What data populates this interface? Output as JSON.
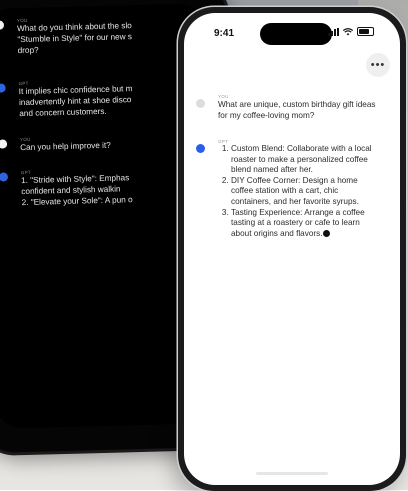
{
  "back_chat": {
    "msg1": {
      "role": "YOU",
      "lines": [
        "What do you think about the slo",
        "\"Stumble in Style\" for our new s",
        "drop?"
      ]
    },
    "msg2": {
      "role": "GPT",
      "lines": [
        "It implies chic confidence but m",
        "inadvertently hint at shoe disco",
        "and concern customers."
      ]
    },
    "msg3": {
      "role": "YOU",
      "lines": [
        "Can you help improve it?"
      ]
    },
    "msg4": {
      "role": "GPT",
      "lines": [
        "1. \"Stride with Style\": Emphas",
        "    confident and stylish walkin",
        "2. \"Elevate your Sole\": A pun o"
      ]
    }
  },
  "front_phone": {
    "status_time": "9:41",
    "menu_label": "•••",
    "user_role": "YOU",
    "user_text": "What are unique, custom birthday gift ideas for my coffee-loving mom?",
    "gpt_role": "GPT",
    "gpt_list": [
      "Custom Blend: Collaborate with a local roaster to make a personalized coffee blend named after her.",
      "DIY Coffee Corner: Design a home coffee station with a cart, chic containers, and her favorite syrups.",
      "Tasting Experience: Arrange a coffee tasting at a roastery or cafe to learn about origins and flavors."
    ]
  },
  "colors": {
    "gpt_dot": "#2a5ee8",
    "back_bg": "#000000",
    "front_bg": "#ffffff"
  },
  "icons": [
    "signal-icon",
    "wifi-icon",
    "battery-icon",
    "more-icon"
  ]
}
